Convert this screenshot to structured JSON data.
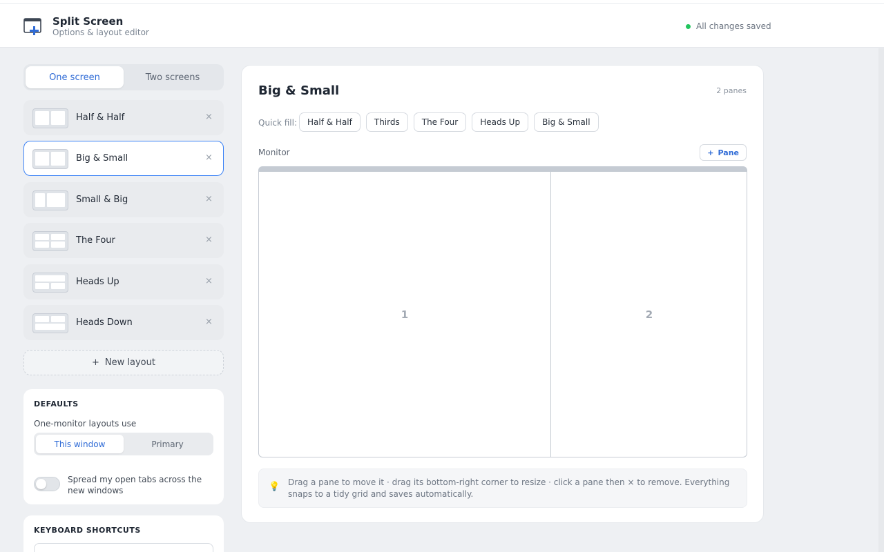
{
  "header": {
    "title": "Split Screen",
    "subtitle": "Options & layout editor",
    "status": "All changes saved",
    "status_color": "#22c55e"
  },
  "sidebar": {
    "screen_toggle": [
      "One screen",
      "Two screens"
    ],
    "screen_toggle_active": "One screen",
    "layouts": [
      {
        "label": "Half & Half",
        "icon": "split-half-icon"
      },
      {
        "label": "Big & Small",
        "icon": "split-big-small-icon",
        "active": true
      },
      {
        "label": "Small & Big",
        "icon": "split-small-big-icon"
      },
      {
        "label": "The Four",
        "icon": "grid-four-icon"
      },
      {
        "label": "Heads Up",
        "icon": "heads-up-icon"
      },
      {
        "label": "Heads Down",
        "icon": "heads-down-icon"
      }
    ],
    "remove_glyph": "×",
    "new_layout_plus": "+",
    "new_layout_label": "New layout"
  },
  "defaults": {
    "title": "DEFAULTS",
    "label": "One-monitor layouts use",
    "options": [
      "This window",
      "Primary"
    ],
    "active": "This window",
    "toggle_label": "Spread my open tabs across the new windows",
    "toggle_on": false
  },
  "shortcuts": {
    "title": "KEYBOARD SHORTCUTS"
  },
  "main": {
    "title": "Big & Small",
    "pane_count": "2 panes",
    "quick_fill_label": "Quick fill:",
    "quick_fill": [
      "Half & Half",
      "Thirds",
      "The Four",
      "Heads Up",
      "Big & Small"
    ],
    "monitor_label": "Monitor",
    "add_pane_plus": "+",
    "add_pane_label": "Pane",
    "panes": [
      "1",
      "2"
    ],
    "hint_icon": "lightbulb-icon",
    "hint": "Drag a pane to move it · drag its bottom-right corner to resize · click a pane then × to remove. Everything snaps to a tidy grid and saves automatically."
  },
  "colors": {
    "accent": "#2f6bd6",
    "active_border": "#3b82f6",
    "background": "#eef0f3"
  }
}
